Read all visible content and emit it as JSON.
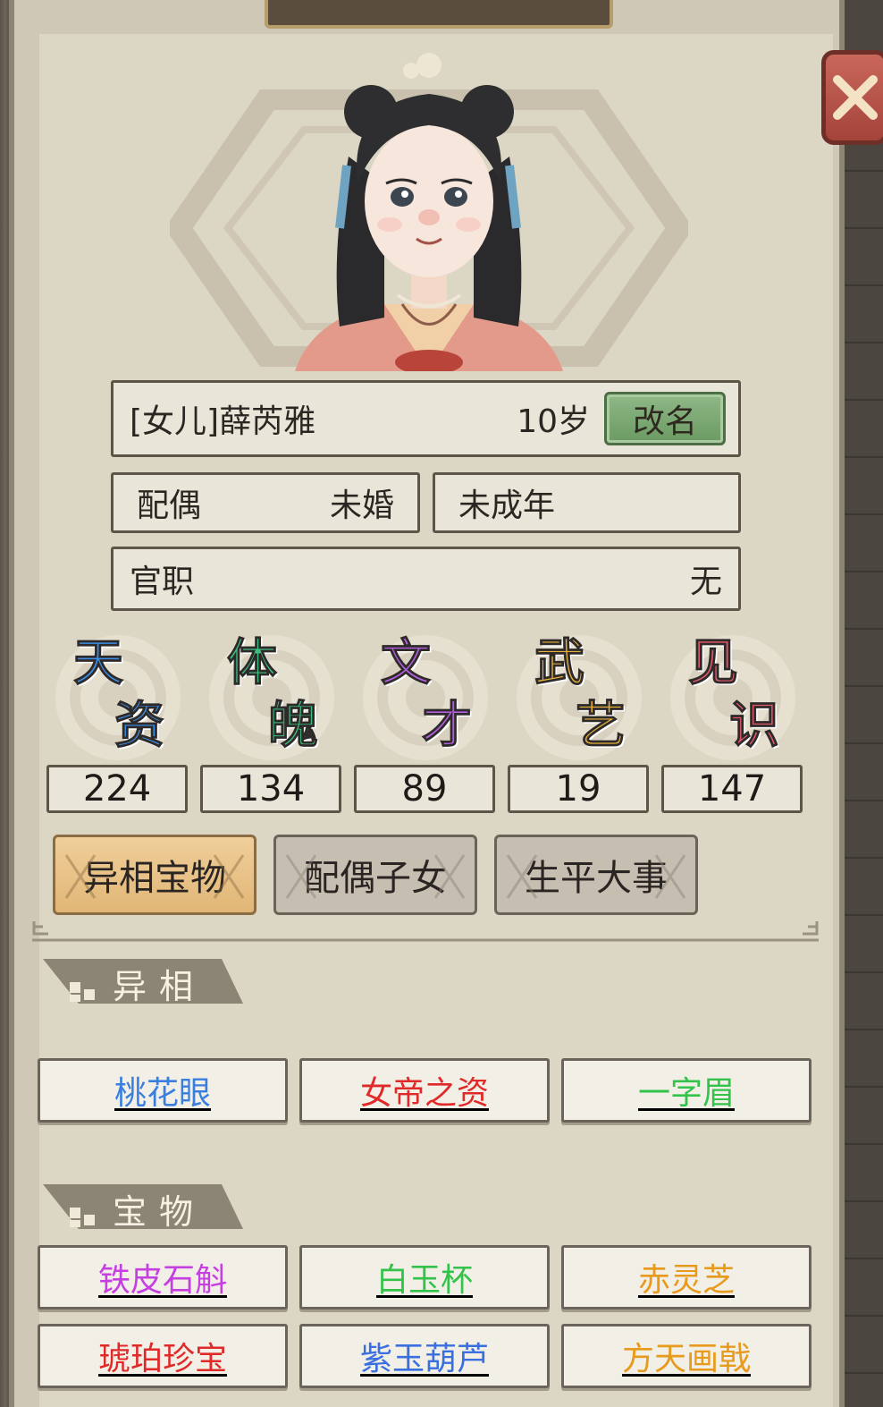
{
  "header": {
    "close_icon": "close-x-icon"
  },
  "character": {
    "name": "[女儿]薛芮雅",
    "age": "10岁",
    "rename_label": "改名",
    "spouse_label": "配偶",
    "spouse_value": "未婚",
    "status": "未成年",
    "office_label": "官职",
    "office_value": "无"
  },
  "stats": [
    {
      "c1": "天",
      "c2": "资",
      "color": "#3a8fe8",
      "value": "224"
    },
    {
      "c1": "体",
      "c2": "魄",
      "color": "#3fbf7f",
      "value": "134"
    },
    {
      "c1": "文",
      "c2": "才",
      "color": "#b45ee0",
      "value": "89"
    },
    {
      "c1": "武",
      "c2": "艺",
      "color": "#e6b23a",
      "value": "19"
    },
    {
      "c1": "见",
      "c2": "识",
      "color": "#e0586a",
      "value": "147"
    }
  ],
  "tabs": [
    "异相宝物",
    "配偶子女",
    "生平大事"
  ],
  "sections": {
    "traits_title": "异相",
    "treasures_title": "宝物"
  },
  "traits": [
    {
      "name": "桃花眼",
      "color": "#3a7fe0"
    },
    {
      "name": "女帝之资",
      "color": "#e02a2a"
    },
    {
      "name": "一字眉",
      "color": "#33c24a"
    }
  ],
  "treasures": [
    {
      "name": "铁皮石斛",
      "color": "#c63fe0"
    },
    {
      "name": "白玉杯",
      "color": "#33c24a"
    },
    {
      "name": "赤灵芝",
      "color": "#e79a1c"
    },
    {
      "name": "琥珀珍宝",
      "color": "#e02a2a"
    },
    {
      "name": "紫玉葫芦",
      "color": "#3a6fe0"
    },
    {
      "name": "方天画戟",
      "color": "#e79a1c"
    }
  ]
}
